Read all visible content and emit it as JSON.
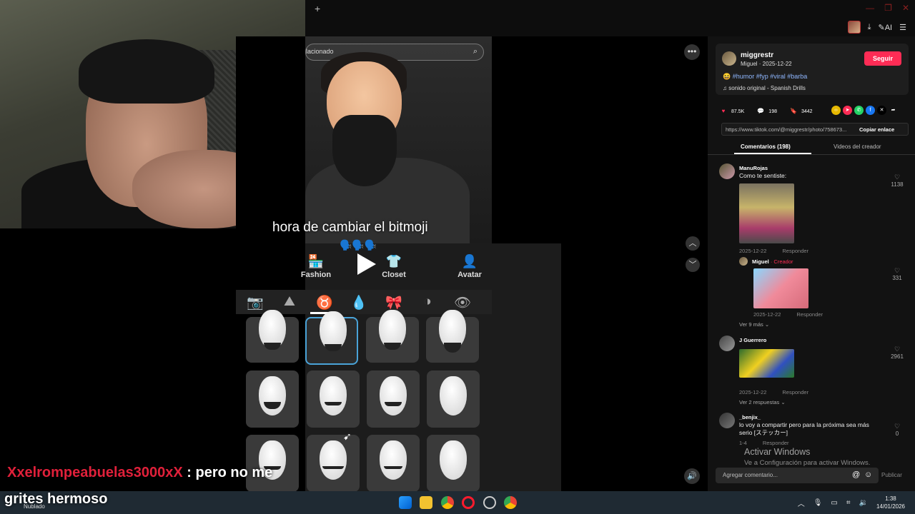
{
  "browser": {
    "new_tab": "+",
    "ai_label": "AI"
  },
  "player": {
    "search_placeholder": "lacionado",
    "caption": "hora de cambiar el bitmoji",
    "caption_emoji": "🗣️🗣️🗣️",
    "tabs": [
      {
        "label": "Fashion",
        "icon": "store-icon"
      },
      {
        "label": "Closet",
        "icon": "hanger-icon"
      },
      {
        "label": "Avatar",
        "icon": "avatar-edit-icon"
      }
    ],
    "category_icons": [
      "camera-icon",
      "hair-icon",
      "beard-icon",
      "skin-drop-icon",
      "accessory-icon",
      "contrast-icon",
      "eye-icon"
    ],
    "selected_category": "beard-icon"
  },
  "post": {
    "creator": "miggrestr",
    "creator_sub": "Miguel · 2025-12-22",
    "follow_label": "Seguir",
    "hashtags": "#humor #fyp #viral #barba",
    "sound": "sonido original - Spanish Drills",
    "likes": "87.5K",
    "comments": "198",
    "saves": "3442",
    "link": "https://www.tiktok.com/@miggrestr/photo/758673...",
    "copy_label": "Copiar enlace",
    "tab_comments": "Comentarios (198)",
    "tab_videos": "Videos del creador",
    "add_comment_placeholder": "Agregar comentario...",
    "at_symbol": "@",
    "publish_label": "Publicar"
  },
  "comments": [
    {
      "user": "ManuRojas",
      "text": "Como te sentiste:",
      "date": "2025-12-22",
      "reply": "Responder",
      "likes": "1138"
    },
    {
      "user": "Miguel",
      "creator_tag": " · Creador",
      "date": "2025-12-22",
      "reply": "Responder",
      "likes": "331",
      "more": "Ver 9 más ⌄"
    },
    {
      "user": "J Guerrero",
      "date": "2025-12-22",
      "reply": "Responder",
      "likes": "2961",
      "more": "Ver 2 respuestas ⌄"
    },
    {
      "user": "_benjix_",
      "text": "lo voy a compartir pero para la próxima sea más serio [ステッカー]",
      "date": "1-4",
      "reply": "Responder",
      "likes": "0"
    }
  ],
  "watermark": {
    "title": "Activar Windows",
    "subtitle": "Ve a Configuración para activar Windows."
  },
  "stream_chat": {
    "user": "Xxelrompeabuelas3000xX",
    "message_part1": ": pero no me",
    "message_part2": "grites hermoso"
  },
  "taskbar": {
    "weather": "Nublado",
    "time": "1:38",
    "date": "14/01/2026"
  }
}
